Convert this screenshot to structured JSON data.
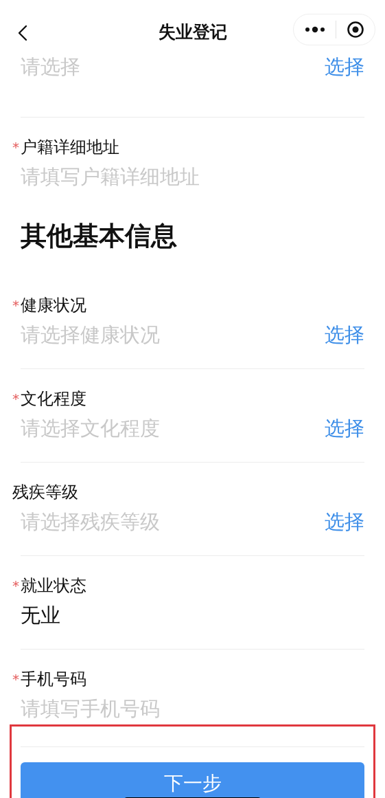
{
  "nav": {
    "title": "失业登记"
  },
  "sections": [
    {
      "fields": [
        {
          "kind": "select",
          "placeholder": "请选择",
          "action": "选择"
        },
        {
          "kind": "input",
          "required_mark": "*",
          "label": "户籍详细地址",
          "placeholder": "请填写户籍详细地址"
        }
      ]
    },
    {
      "heading": "其他基本信息",
      "fields": [
        {
          "kind": "select",
          "required_mark": "*",
          "label": "健康状况",
          "placeholder": "请选择健康状况",
          "action": "选择"
        },
        {
          "kind": "select",
          "required_mark": "*",
          "label": "文化程度",
          "placeholder": "请选择文化程度",
          "action": "选择"
        },
        {
          "kind": "select",
          "label": "残疾等级",
          "placeholder": "请选择残疾等级",
          "action": "选择"
        },
        {
          "kind": "input",
          "required_mark": "*",
          "label": "就业状态",
          "value": "无业"
        },
        {
          "kind": "input",
          "required_mark": "*",
          "label": "手机号码",
          "placeholder": "请填写手机号码"
        }
      ]
    }
  ],
  "footer": {
    "button": "下一步"
  }
}
